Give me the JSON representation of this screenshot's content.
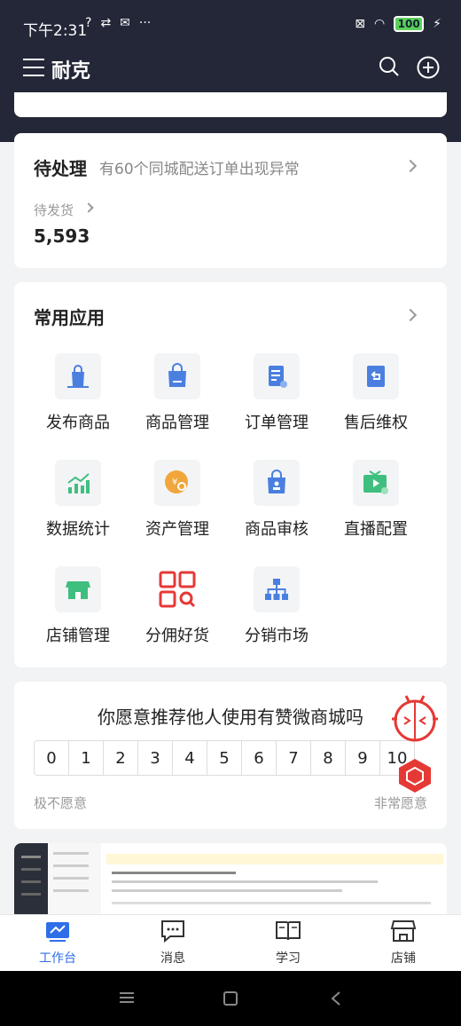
{
  "status": {
    "time": "下午2:31",
    "battery": "100"
  },
  "nav": {
    "title": "耐克"
  },
  "pending": {
    "title": "待处理",
    "notice": "有60个同城配送订单出现异常",
    "label": "待发货",
    "value": "5,593"
  },
  "apps": {
    "title": "常用应用",
    "items": [
      {
        "label": "发布商品",
        "icon": "publish-bag-icon"
      },
      {
        "label": "商品管理",
        "icon": "bag-icon"
      },
      {
        "label": "订单管理",
        "icon": "order-doc-icon"
      },
      {
        "label": "售后维权",
        "icon": "return-icon"
      },
      {
        "label": "数据统计",
        "icon": "chart-icon"
      },
      {
        "label": "资产管理",
        "icon": "coin-icon"
      },
      {
        "label": "商品审核",
        "icon": "stamp-icon"
      },
      {
        "label": "直播配置",
        "icon": "tv-icon"
      },
      {
        "label": "店铺管理",
        "icon": "store-icon"
      },
      {
        "label": "分佣好货",
        "icon": "grid-search-icon"
      },
      {
        "label": "分销市场",
        "icon": "hierarchy-icon"
      }
    ]
  },
  "survey": {
    "question": "你愿意推荐他人使用有赞微商城吗",
    "scale": [
      "0",
      "1",
      "2",
      "3",
      "4",
      "5",
      "6",
      "7",
      "8",
      "9",
      "10"
    ],
    "low_label": "极不愿意",
    "high_label": "非常愿意"
  },
  "tabs": [
    {
      "label": "工作台",
      "icon": "workbench-icon",
      "active": true
    },
    {
      "label": "消息",
      "icon": "message-icon",
      "active": false
    },
    {
      "label": "学习",
      "icon": "book-icon",
      "active": false
    },
    {
      "label": "店铺",
      "icon": "shop-icon",
      "active": false
    }
  ],
  "colors": {
    "header": "#232737",
    "accent": "#2f6ee8",
    "icon_blue": "#4a7fe0",
    "icon_green": "#3fbf7f",
    "icon_orange": "#f0a63a",
    "icon_red": "#e53935"
  }
}
